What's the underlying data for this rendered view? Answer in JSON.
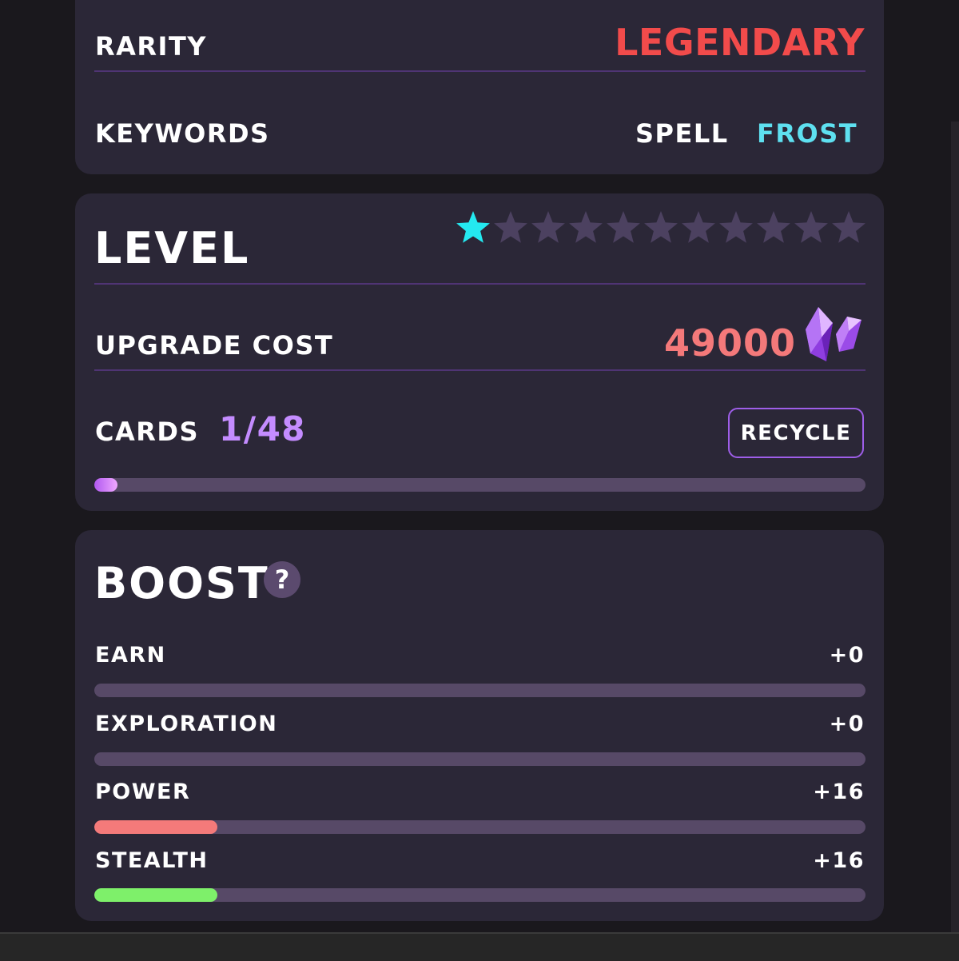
{
  "info": {
    "rarity_label": "RARITY",
    "rarity_value": "LEGENDARY",
    "keywords_label": "KEYWORDS",
    "keywords": [
      "SPELL",
      "FROST"
    ]
  },
  "level": {
    "title": "LEVEL",
    "stars_filled": 1,
    "stars_total": 11,
    "upgrade_cost_label": "UPGRADE COST",
    "upgrade_cost_value": "49000",
    "cost_icon": "purple-crystal-icon",
    "cards_label": "CARDS",
    "cards_value": "1/48",
    "cards_progress": 0.021,
    "recycle_label": "RECYCLE"
  },
  "boost": {
    "title": "BOOST",
    "help_glyph": "?",
    "stats": [
      {
        "label": "EARN",
        "value": "+0",
        "fill": 0.0,
        "color": "#f47a7a"
      },
      {
        "label": "EXPLORATION",
        "value": "+0",
        "fill": 0.0,
        "color": "#f47a7a"
      },
      {
        "label": "POWER",
        "value": "+16",
        "fill": 0.16,
        "color": "#f47a7a"
      },
      {
        "label": "STEALTH",
        "value": "+16",
        "fill": 0.16,
        "color": "#7ef06a"
      }
    ]
  },
  "colors": {
    "legendary": "#f24b4b",
    "spell": "#ffffff",
    "frost": "#5ee0f0",
    "star_active": "#24e9f0",
    "star_inactive": "#4c4160",
    "cost": "#f4797a",
    "cards_count": "#c48cff",
    "divider": "#4f3474"
  }
}
